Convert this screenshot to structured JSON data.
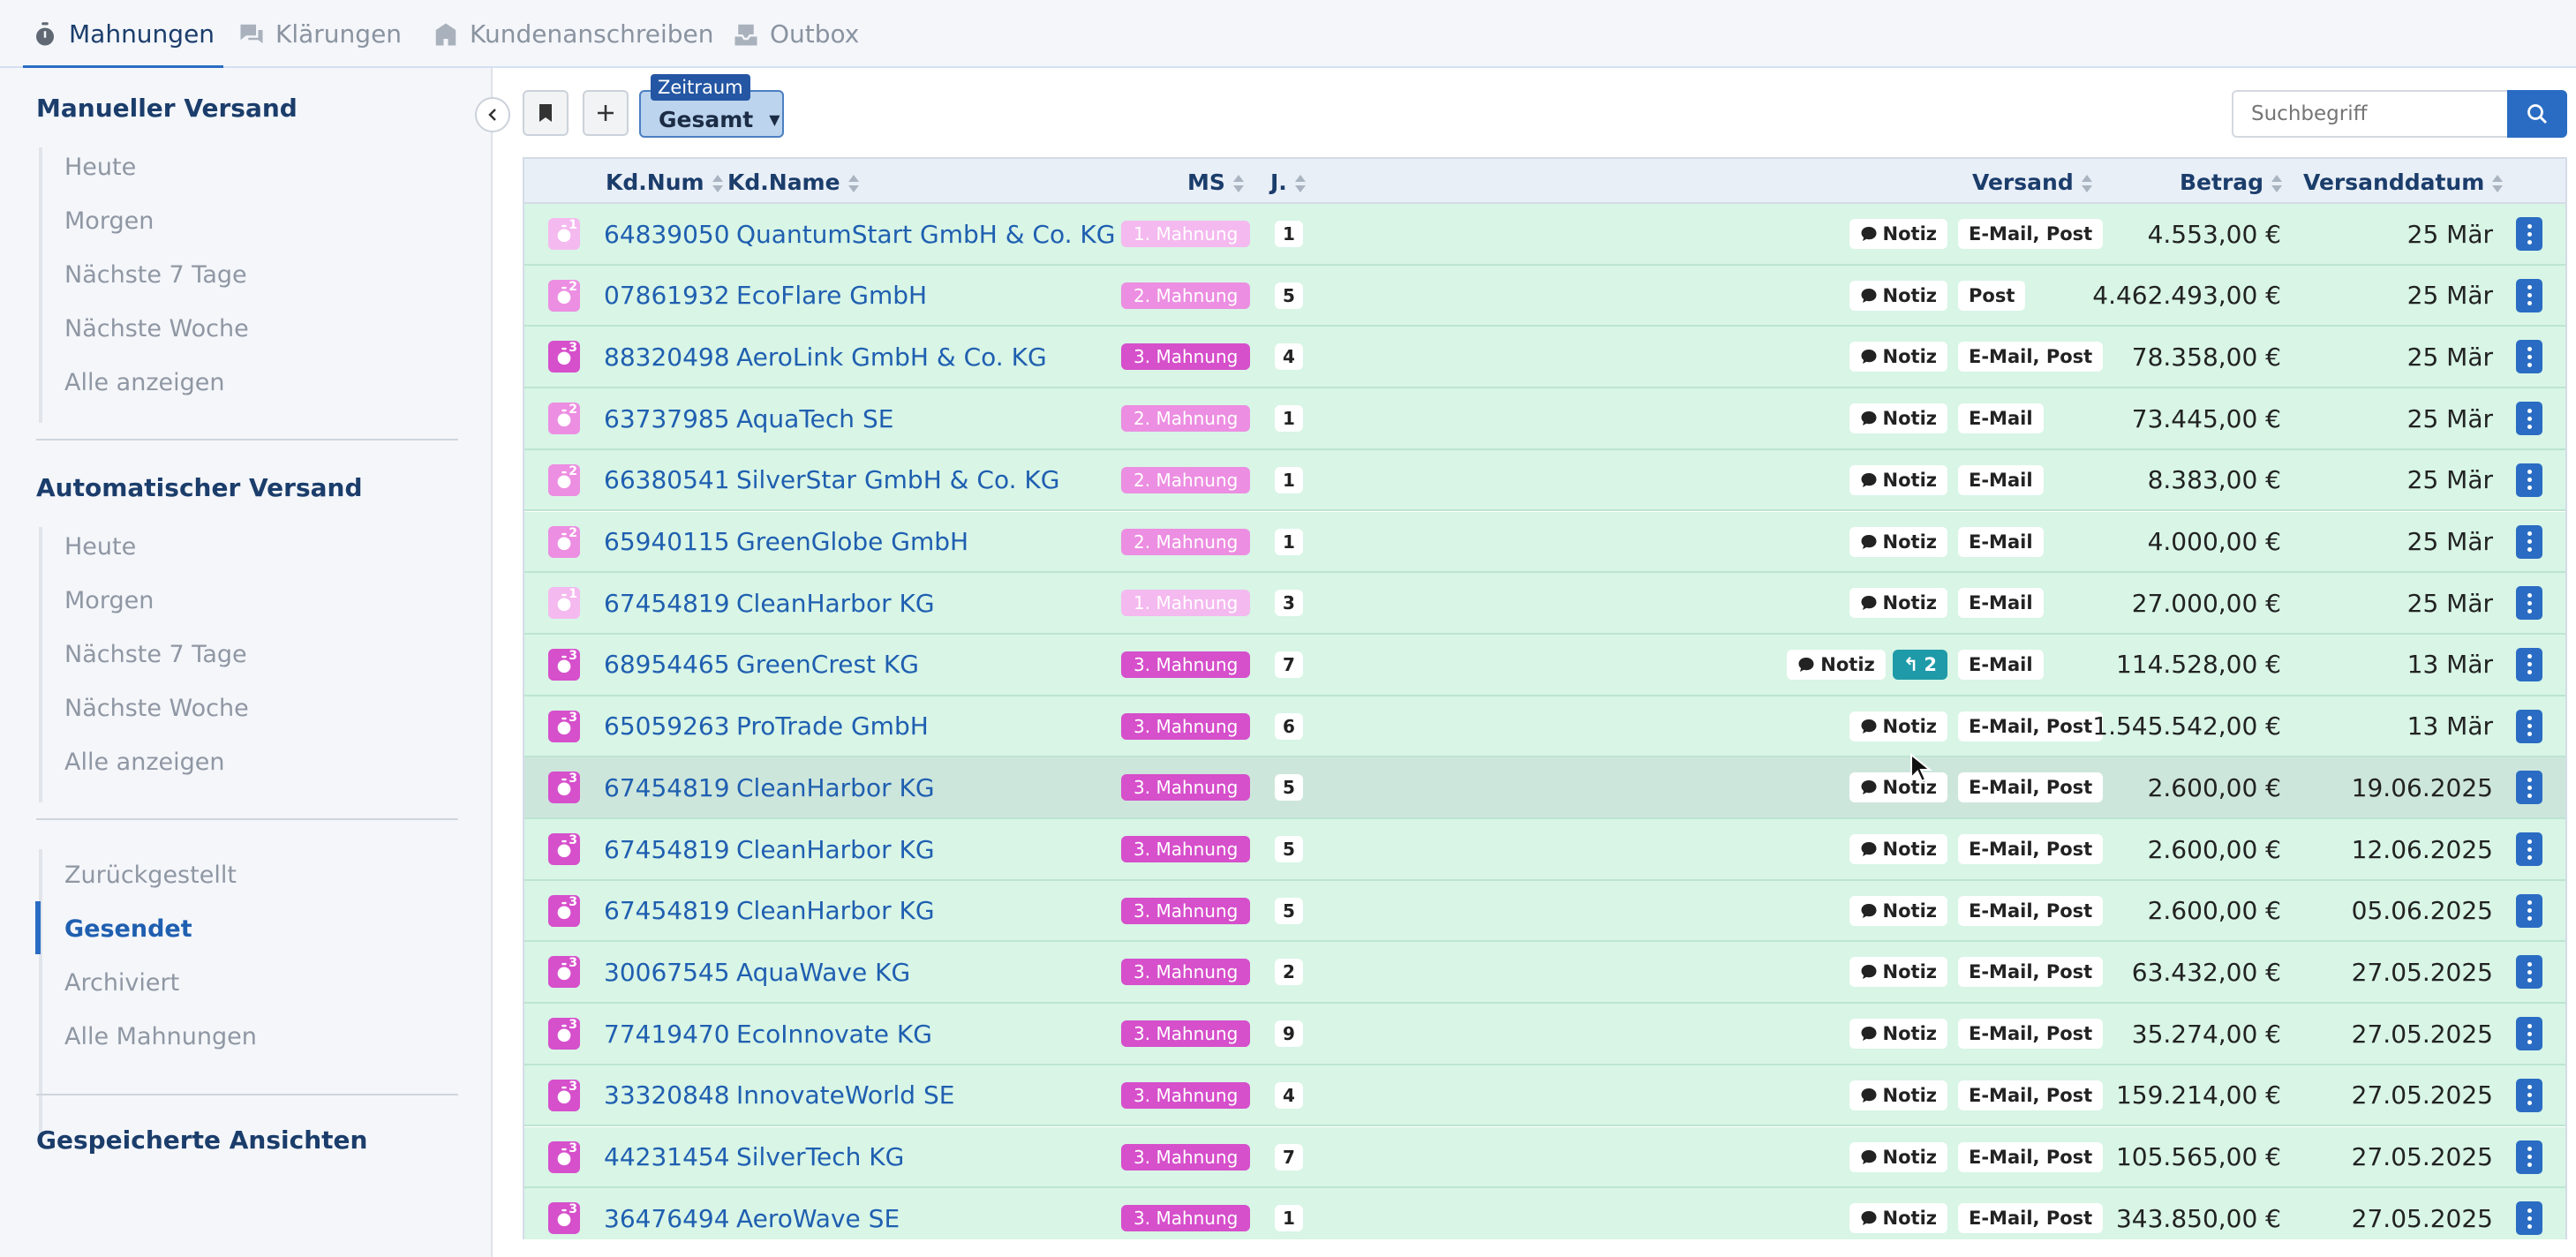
{
  "tabs": [
    {
      "label": "Mahnungen",
      "icon": "stopwatch-icon",
      "active": true
    },
    {
      "label": "Klärungen",
      "icon": "chat-bubbles-icon",
      "active": false
    },
    {
      "label": "Kundenanschreiben",
      "icon": "building-icon",
      "active": false
    },
    {
      "label": "Outbox",
      "icon": "outbox-icon",
      "active": false
    }
  ],
  "sidebar": {
    "manual_heading": "Manueller Versand",
    "manual_items": [
      "Heute",
      "Morgen",
      "Nächste 7 Tage",
      "Nächste Woche",
      "Alle anzeigen"
    ],
    "auto_heading": "Automatischer Versand",
    "auto_items": [
      "Heute",
      "Morgen",
      "Nächste 7 Tage",
      "Nächste Woche",
      "Alle anzeigen"
    ],
    "status_items": [
      "Zurückgestellt",
      "Gesendet",
      "Archiviert",
      "Alle Mahnungen"
    ],
    "active_status": "Gesendet",
    "saved_heading": "Gespeicherte Ansichten"
  },
  "toolbar": {
    "zeitraum_label": "Zeitraum",
    "zeitraum_value": "Gesamt",
    "search_placeholder": "Suchbegriff"
  },
  "table": {
    "columns": {
      "kdnum": "Kd.Num",
      "kdname": "Kd.Name",
      "ms": "MS",
      "j": "J.",
      "versand": "Versand",
      "betrag": "Betrag",
      "versanddatum": "Versanddatum"
    },
    "note_label": "Notiz",
    "level_colors": {
      "1": "#f4b9ef",
      "2": "#ec8ee1",
      "3": "#d64fcb"
    },
    "rows": [
      {
        "level": 1,
        "kdnum": "64839050",
        "kdname": "QuantumStart GmbH & Co. KG",
        "ms": "1. Mahnung",
        "j": "1",
        "replies": "",
        "versand": "E-Mail, Post",
        "betrag": "4.553,00 €",
        "datum": "25 Mär"
      },
      {
        "level": 2,
        "kdnum": "07861932",
        "kdname": "EcoFlare GmbH",
        "ms": "2. Mahnung",
        "j": "5",
        "replies": "",
        "versand": "Post",
        "betrag": "4.462.493,00 €",
        "datum": "25 Mär"
      },
      {
        "level": 3,
        "kdnum": "88320498",
        "kdname": "AeroLink GmbH & Co. KG",
        "ms": "3. Mahnung",
        "j": "4",
        "replies": "",
        "versand": "E-Mail, Post",
        "betrag": "78.358,00 €",
        "datum": "25 Mär"
      },
      {
        "level": 2,
        "kdnum": "63737985",
        "kdname": "AquaTech SE",
        "ms": "2. Mahnung",
        "j": "1",
        "replies": "",
        "versand": "E-Mail",
        "betrag": "73.445,00 €",
        "datum": "25 Mär"
      },
      {
        "level": 2,
        "kdnum": "66380541",
        "kdname": "SilverStar GmbH & Co. KG",
        "ms": "2. Mahnung",
        "j": "1",
        "replies": "",
        "versand": "E-Mail",
        "betrag": "8.383,00 €",
        "datum": "25 Mär"
      },
      {
        "level": 2,
        "kdnum": "65940115",
        "kdname": "GreenGlobe GmbH",
        "ms": "2. Mahnung",
        "j": "1",
        "replies": "",
        "versand": "E-Mail",
        "betrag": "4.000,00 €",
        "datum": "25 Mär"
      },
      {
        "level": 1,
        "kdnum": "67454819",
        "kdname": "CleanHarbor KG",
        "ms": "1. Mahnung",
        "j": "3",
        "replies": "",
        "versand": "E-Mail",
        "betrag": "27.000,00 €",
        "datum": "25 Mär"
      },
      {
        "level": 3,
        "kdnum": "68954465",
        "kdname": "GreenCrest KG",
        "ms": "3. Mahnung",
        "j": "7",
        "replies": "2",
        "versand": "E-Mail",
        "betrag": "114.528,00 €",
        "datum": "13 Mär"
      },
      {
        "level": 3,
        "kdnum": "65059263",
        "kdname": "ProTrade GmbH",
        "ms": "3. Mahnung",
        "j": "6",
        "replies": "",
        "versand": "E-Mail, Post",
        "betrag": "1.545.542,00 €",
        "datum": "13 Mär"
      },
      {
        "level": 3,
        "kdnum": "67454819",
        "kdname": "CleanHarbor KG",
        "ms": "3. Mahnung",
        "j": "5",
        "replies": "",
        "versand": "E-Mail, Post",
        "betrag": "2.600,00 €",
        "datum": "19.06.2025",
        "hover": true
      },
      {
        "level": 3,
        "kdnum": "67454819",
        "kdname": "CleanHarbor KG",
        "ms": "3. Mahnung",
        "j": "5",
        "replies": "",
        "versand": "E-Mail, Post",
        "betrag": "2.600,00 €",
        "datum": "12.06.2025"
      },
      {
        "level": 3,
        "kdnum": "67454819",
        "kdname": "CleanHarbor KG",
        "ms": "3. Mahnung",
        "j": "5",
        "replies": "",
        "versand": "E-Mail, Post",
        "betrag": "2.600,00 €",
        "datum": "05.06.2025"
      },
      {
        "level": 3,
        "kdnum": "30067545",
        "kdname": "AquaWave KG",
        "ms": "3. Mahnung",
        "j": "2",
        "replies": "",
        "versand": "E-Mail, Post",
        "betrag": "63.432,00 €",
        "datum": "27.05.2025"
      },
      {
        "level": 3,
        "kdnum": "77419470",
        "kdname": "EcoInnovate KG",
        "ms": "3. Mahnung",
        "j": "9",
        "replies": "",
        "versand": "E-Mail, Post",
        "betrag": "35.274,00 €",
        "datum": "27.05.2025"
      },
      {
        "level": 3,
        "kdnum": "33320848",
        "kdname": "InnovateWorld SE",
        "ms": "3. Mahnung",
        "j": "4",
        "replies": "",
        "versand": "E-Mail, Post",
        "betrag": "159.214,00 €",
        "datum": "27.05.2025"
      },
      {
        "level": 3,
        "kdnum": "44231454",
        "kdname": "SilverTech KG",
        "ms": "3. Mahnung",
        "j": "7",
        "replies": "",
        "versand": "E-Mail, Post",
        "betrag": "105.565,00 €",
        "datum": "27.05.2025"
      },
      {
        "level": 3,
        "kdnum": "36476494",
        "kdname": "AeroWave SE",
        "ms": "3. Mahnung",
        "j": "1",
        "replies": "",
        "versand": "E-Mail, Post",
        "betrag": "343.850,00 €",
        "datum": "27.05.2025"
      }
    ]
  }
}
